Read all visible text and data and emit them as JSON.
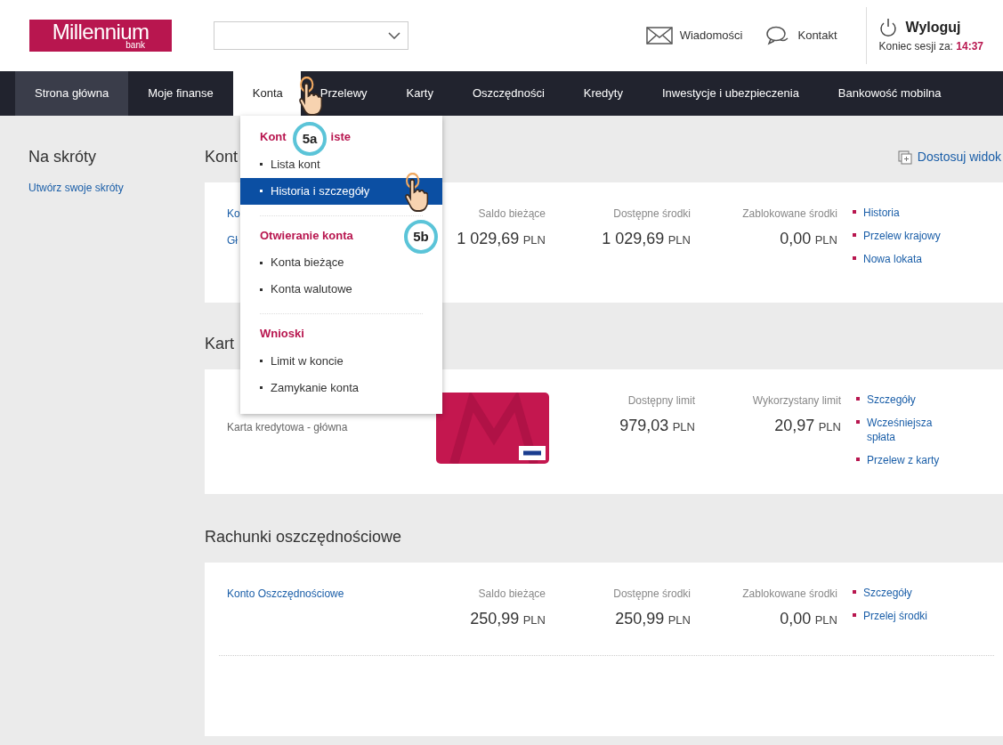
{
  "header": {
    "logo": {
      "name": "Millennium",
      "sub": "bank"
    },
    "links": [
      {
        "kind": "mail",
        "label": "Wiadomości"
      },
      {
        "kind": "chat",
        "label": "Kontakt"
      }
    ],
    "logout": {
      "label": "Wyloguj",
      "session_label": "Koniec sesji za:",
      "session_time": "14:37"
    }
  },
  "nav": [
    {
      "label": "Strona główna",
      "selected": false,
      "highlighted": true
    },
    {
      "label": "Moje finanse",
      "selected": false,
      "highlighted": false
    },
    {
      "label": "Konta",
      "selected": true,
      "highlighted": false
    },
    {
      "label": "Przelewy",
      "selected": false,
      "highlighted": false
    },
    {
      "label": "Karty",
      "selected": false,
      "highlighted": false
    },
    {
      "label": "Oszczędności",
      "selected": false,
      "highlighted": false
    },
    {
      "label": "Kredyty",
      "selected": false,
      "highlighted": false
    },
    {
      "label": "Inwestycje i ubezpieczenia",
      "selected": false,
      "highlighted": false
    },
    {
      "label": "Bankowość mobilna",
      "selected": false,
      "highlighted": false
    }
  ],
  "sidebar": {
    "title": "Na skróty",
    "link": "Utwórz swoje skróty"
  },
  "customize": "Dostosuj widok",
  "sections": [
    {
      "title": "Kont",
      "rows": [
        {
          "names": [
            "Ko",
            "Gł"
          ],
          "kind": "account",
          "columns": [
            {
              "label": "Saldo bieżące",
              "value": "1 029,69",
              "currency": "PLN"
            },
            {
              "label": "Dostępne środki",
              "value": "1 029,69",
              "currency": "PLN"
            },
            {
              "label": "Zablokowane środki",
              "value": "0,00",
              "currency": "PLN"
            }
          ],
          "links": [
            "Historia",
            "Przelew krajowy",
            "Nowa lokata"
          ]
        }
      ]
    },
    {
      "title": "Kart",
      "rows": [
        {
          "names": [
            "Karta kredytowa - główna"
          ],
          "kind": "card",
          "columns": [
            {
              "label": "Dostępny limit",
              "value": "979,03",
              "currency": "PLN"
            },
            {
              "label": "Wykorzystany limit",
              "value": "20,97",
              "currency": "PLN"
            }
          ],
          "links": [
            "Szczegóły",
            "Wcześniejsza spłata",
            "Przelew z karty"
          ]
        }
      ]
    },
    {
      "title": "Rachunki oszczędnościowe",
      "rows": [
        {
          "names": [
            "Konto Oszczędnościowe"
          ],
          "kind": "account",
          "columns": [
            {
              "label": "Saldo bieżące",
              "value": "250,99",
              "currency": "PLN"
            },
            {
              "label": "Dostępne środki",
              "value": "250,99",
              "currency": "PLN"
            },
            {
              "label": "Zablokowane środki",
              "value": "0,00",
              "currency": "PLN"
            }
          ],
          "links": [
            "Szczegóły",
            "Przelej środki"
          ]
        }
      ]
    }
  ],
  "dropdown": {
    "groups": [
      {
        "title_parts": [
          "Kont",
          "iste"
        ],
        "items": [
          {
            "label": "Lista kont",
            "selected": false
          },
          {
            "label": "Historia i szczegóły",
            "selected": true
          }
        ]
      },
      {
        "title_parts": [
          "Otwieranie konta"
        ],
        "items": [
          {
            "label": "Konta bieżące",
            "selected": false
          },
          {
            "label": "Konta walutowe",
            "selected": false
          }
        ]
      },
      {
        "title_parts": [
          "Wnioski"
        ],
        "items": [
          {
            "label": "Limit w koncie",
            "selected": false
          },
          {
            "label": "Zamykanie konta",
            "selected": false
          }
        ]
      }
    ]
  },
  "annotations": [
    {
      "label": "5a"
    },
    {
      "label": "5b"
    }
  ]
}
